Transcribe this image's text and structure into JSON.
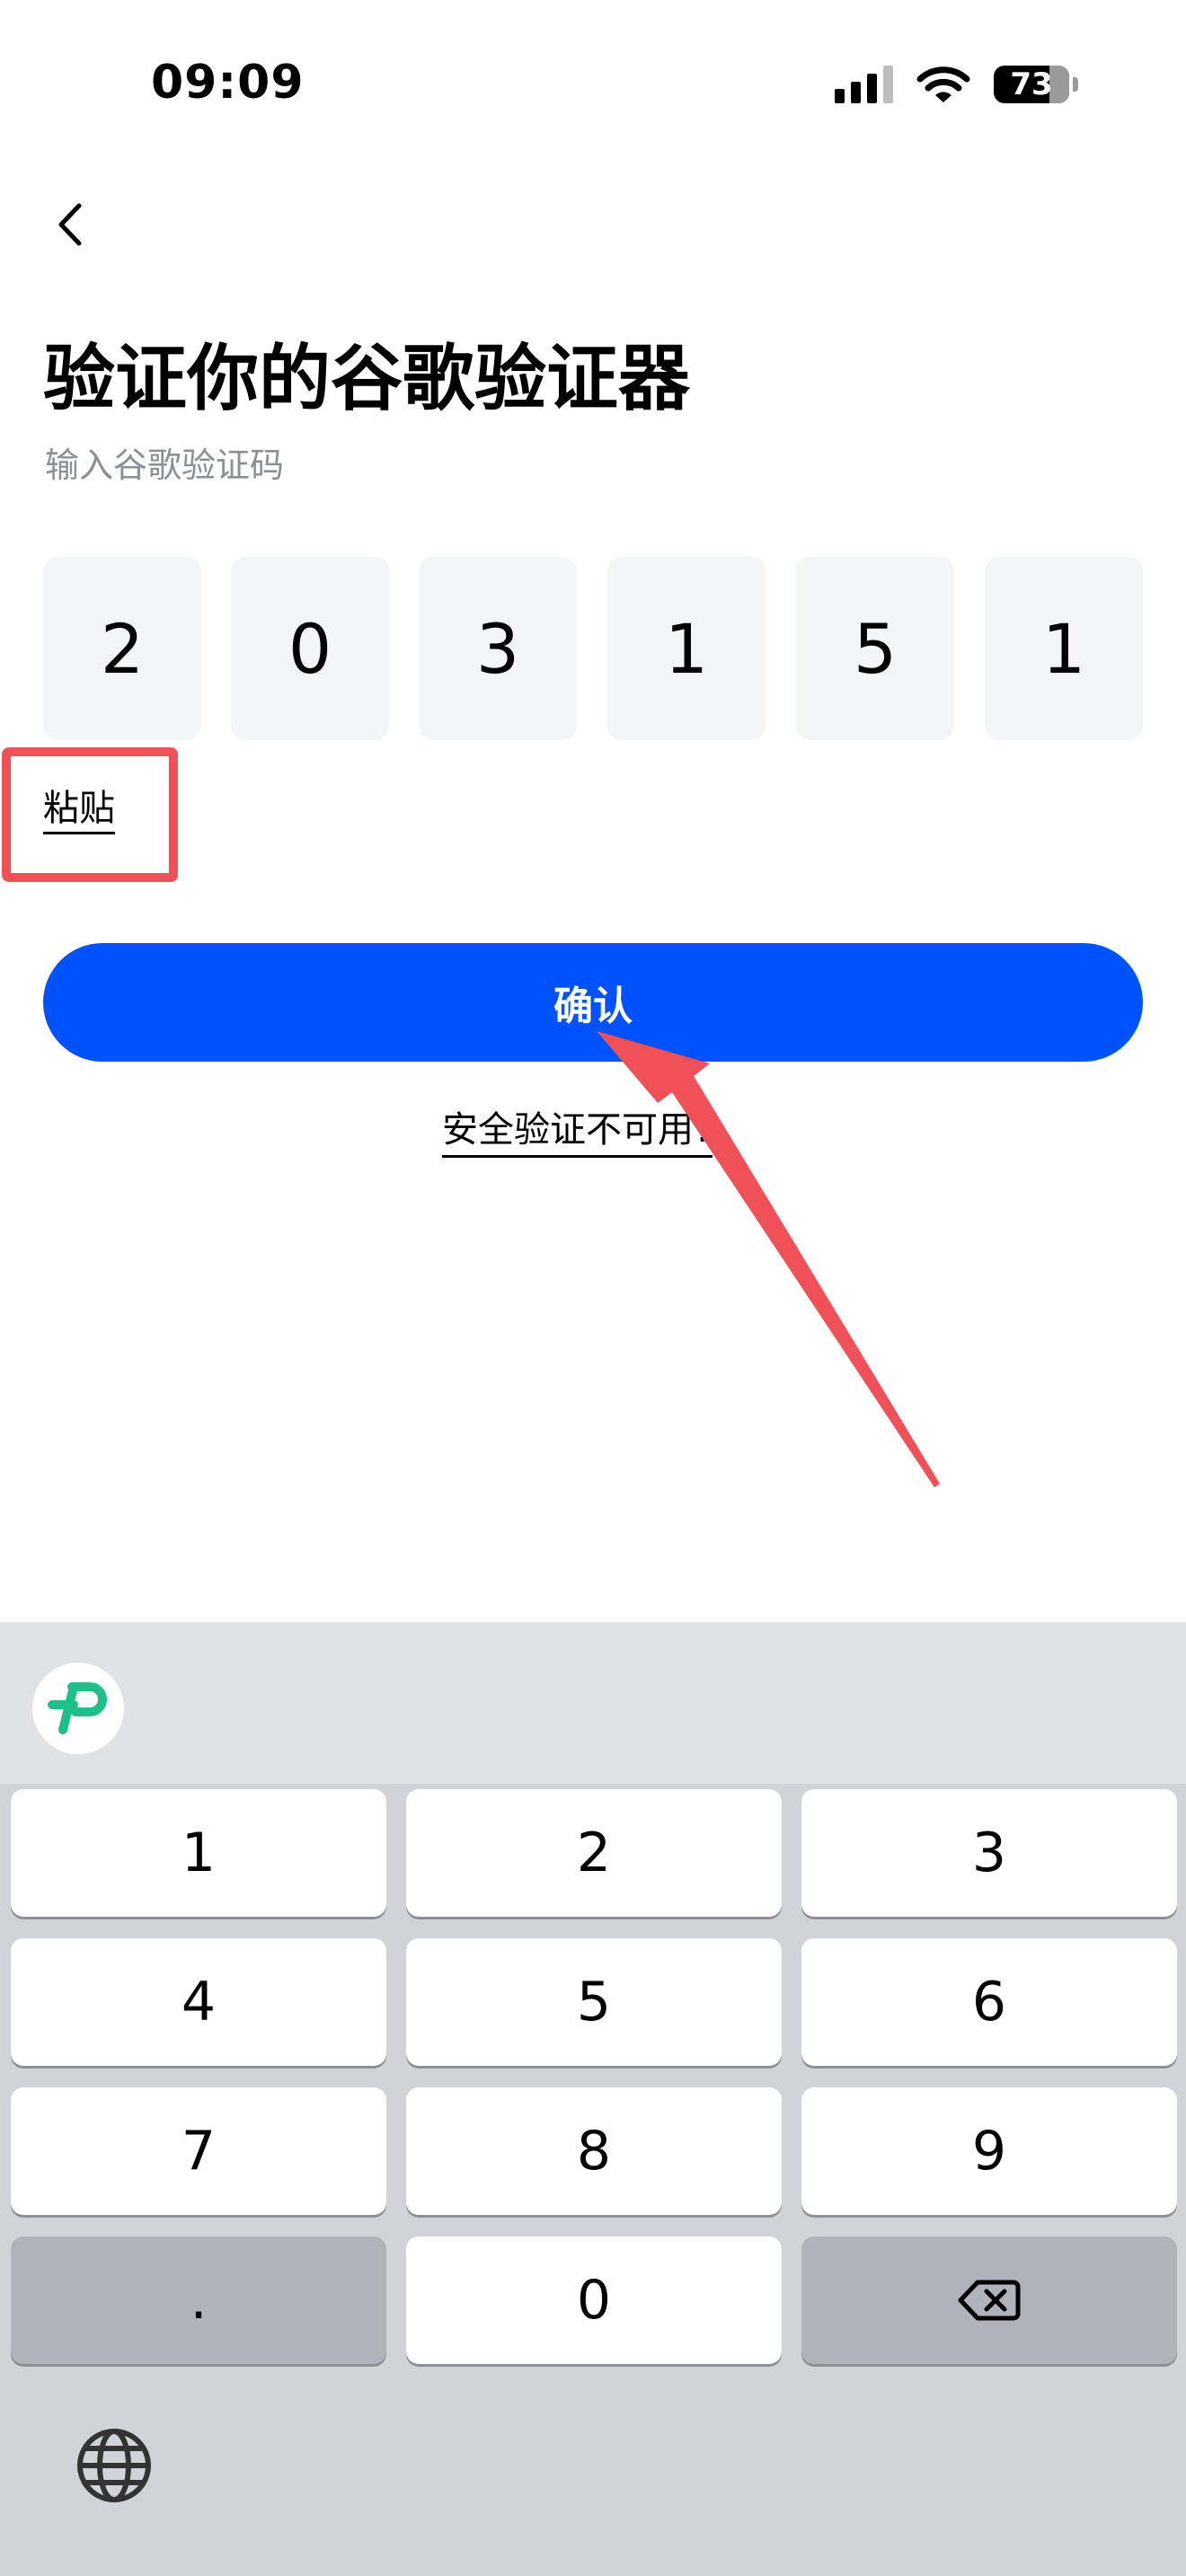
{
  "status_bar": {
    "time": "09:09",
    "battery": "73"
  },
  "header": {
    "title": "验证你的谷歌验证器",
    "subtitle": "输入谷歌验证码"
  },
  "code": {
    "digits": [
      "2",
      "0",
      "3",
      "1",
      "5",
      "1"
    ]
  },
  "actions": {
    "paste_label": "粘贴",
    "confirm_label": "确认",
    "security_link": "安全验证不可用?"
  },
  "keyboard": {
    "keys": [
      "1",
      "2",
      "3",
      "4",
      "5",
      "6",
      "7",
      "8",
      "9",
      ".",
      "0"
    ]
  },
  "colors": {
    "primary": "#0052ff",
    "highlight": "#f05058",
    "code_box": "#f4f5f7",
    "keyboard_bg": "#d1d3d9",
    "logo": "#1fbf8a"
  }
}
